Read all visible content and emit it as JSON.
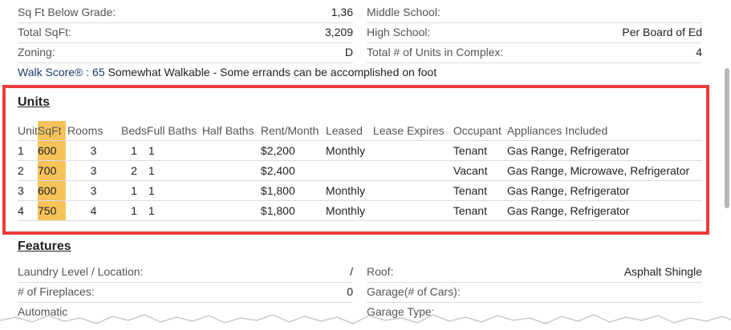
{
  "details": {
    "left": [
      {
        "label": "Sq Ft Below Grade:",
        "value": "1,36"
      },
      {
        "label": "Total SqFt:",
        "value": "3,209"
      },
      {
        "label": "Zoning:",
        "value": "D"
      }
    ],
    "right": [
      {
        "label": "Middle School:",
        "value": ""
      },
      {
        "label": "High School:",
        "value": "Per Board of Ed"
      },
      {
        "label": "Total # of Units in Complex:",
        "value": "4"
      }
    ],
    "walk_score_link": "Walk Score® : 65",
    "walk_score_text": " Somewhat Walkable - Some errands can be accomplished on foot"
  },
  "units": {
    "title": "Units",
    "headers": [
      "Unit",
      "SqFt",
      "Rooms",
      "Beds",
      "Full Baths",
      "Half Baths",
      "Rent/Month",
      "Leased",
      "Lease Expires",
      "Occupant",
      "Appliances Included"
    ],
    "rows": [
      [
        "1",
        "600",
        "3",
        "1",
        "1",
        "",
        "$2,200",
        "Monthly",
        "",
        "Tenant",
        "Gas Range, Refrigerator"
      ],
      [
        "2",
        "700",
        "3",
        "2",
        "1",
        "",
        "$2,400",
        "",
        "",
        "Vacant",
        "Gas Range, Microwave, Refrigerator"
      ],
      [
        "3",
        "600",
        "3",
        "1",
        "1",
        "",
        "$1,800",
        "Monthly",
        "",
        "Tenant",
        "Gas Range, Refrigerator"
      ],
      [
        "4",
        "750",
        "4",
        "1",
        "1",
        "",
        "$1,800",
        "Monthly",
        "",
        "Tenant",
        "Gas Range, Refrigerator"
      ]
    ]
  },
  "features": {
    "title": "Features",
    "left": [
      {
        "label": "Laundry Level / Location:",
        "value": "/"
      },
      {
        "label": "# of Fireplaces:",
        "value": "0"
      },
      {
        "label": "Automatic",
        "value": ""
      }
    ],
    "right": [
      {
        "label": "Roof:",
        "value": "Asphalt Shingle"
      },
      {
        "label": "Garage(# of Cars):",
        "value": ""
      },
      {
        "label": "Garage Type:",
        "value": ""
      }
    ]
  },
  "colors": {
    "highlight_border": "#ee3a3a",
    "sqft_column": "#f5c35a",
    "link_text": "#1a3a6a"
  }
}
